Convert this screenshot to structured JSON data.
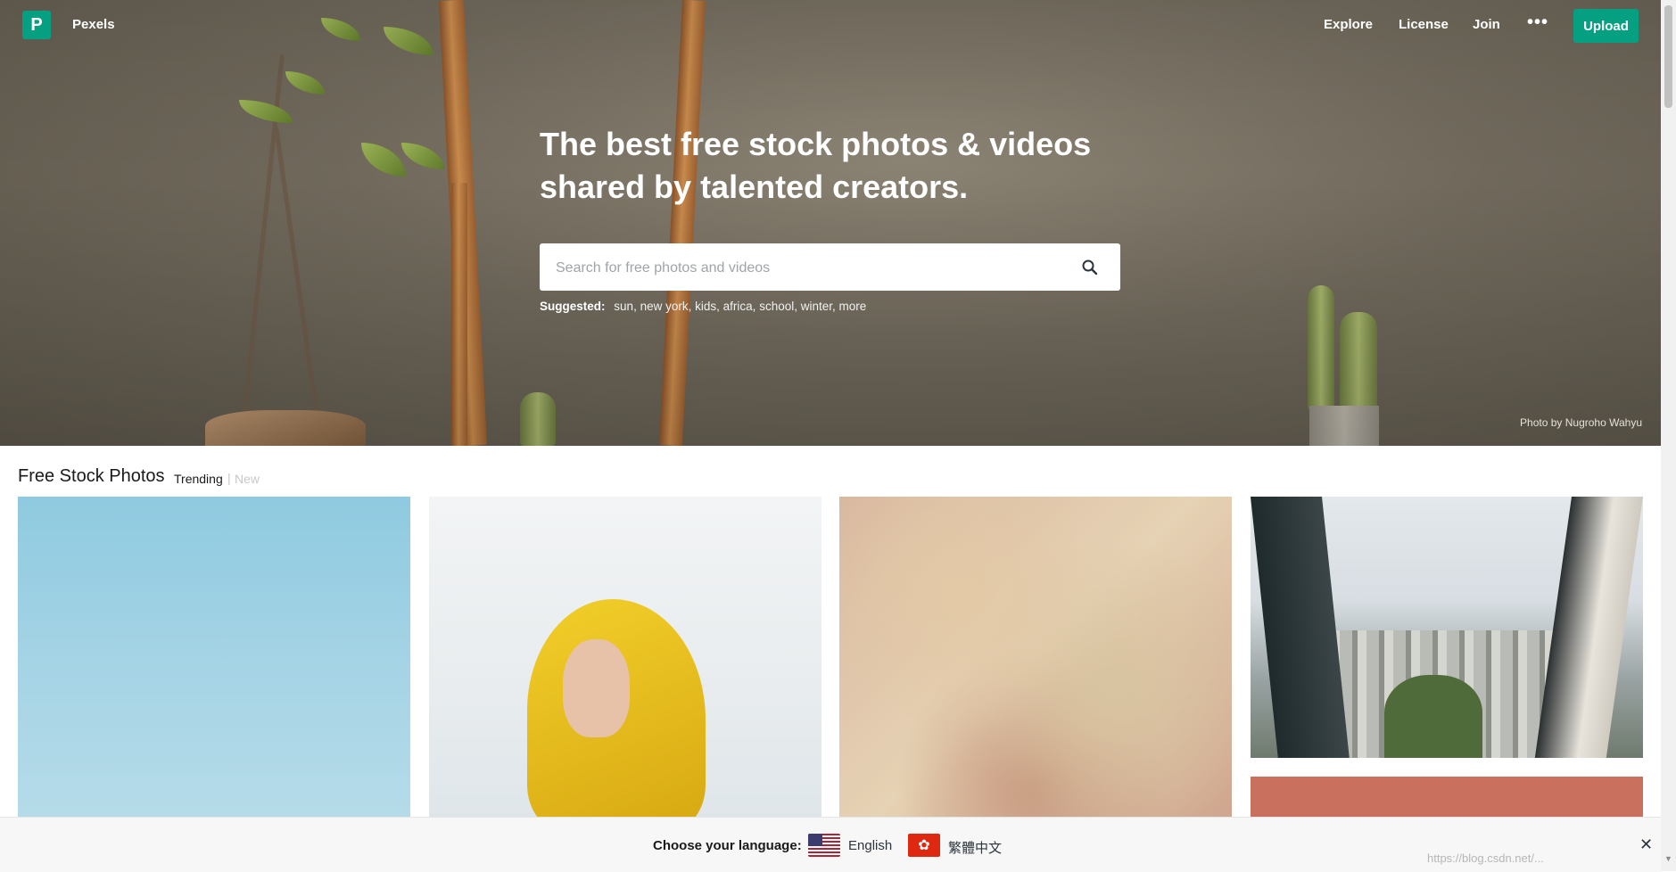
{
  "header": {
    "logo_glyph": "P",
    "brand": "Pexels",
    "nav": [
      "Explore",
      "License",
      "Join"
    ],
    "more_glyph": "•••",
    "upload": "Upload"
  },
  "hero": {
    "headline_line1": "The best free stock photos & videos",
    "headline_line2": "shared by talented creators.",
    "search_placeholder": "Search for free photos and videos",
    "suggested_label": "Suggested:",
    "suggested_tags": [
      "sun",
      "new york",
      "kids",
      "africa",
      "school",
      "winter",
      "more"
    ],
    "credit": "Photo by Nugroho Wahyu"
  },
  "feed": {
    "title": "Free Stock Photos",
    "tab_trending": "Trending",
    "tab_separator": "|",
    "tab_new": "New"
  },
  "language_bar": {
    "label": "Choose your language:",
    "options": [
      "English",
      "繁體中文"
    ],
    "close_glyph": "✕",
    "watermark": "https://blog.csdn.net/..."
  },
  "colors": {
    "accent": "#05a081"
  }
}
